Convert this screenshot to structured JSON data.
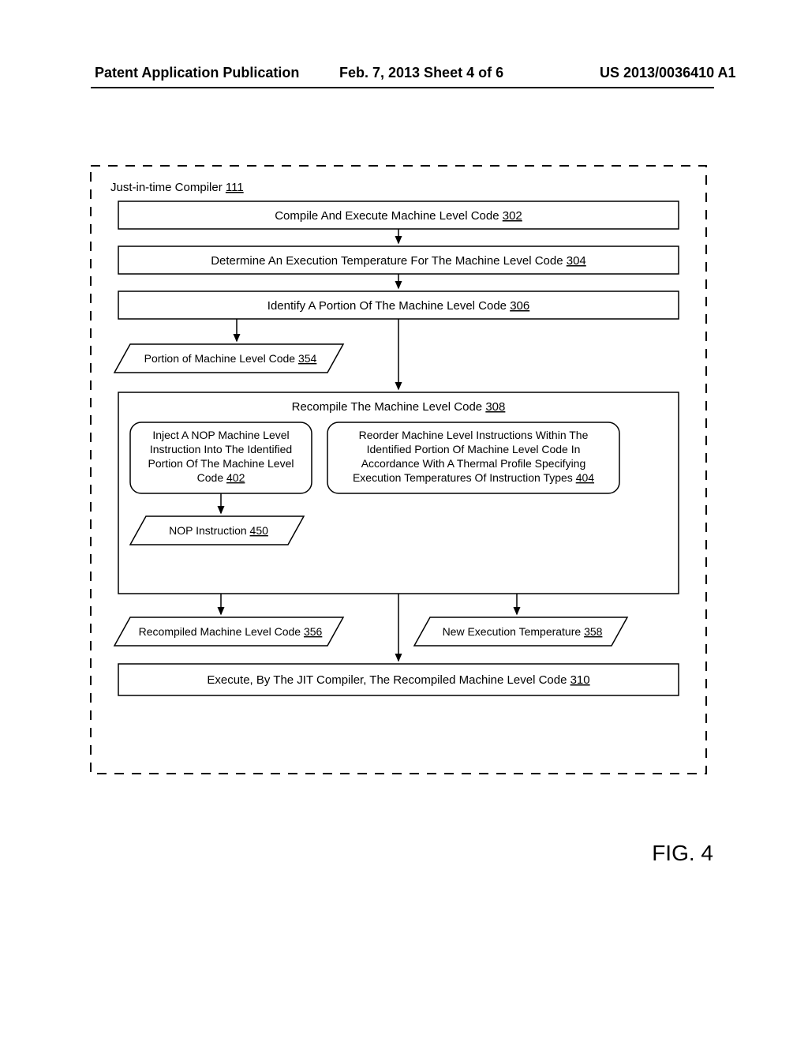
{
  "header": {
    "left": "Patent Application Publication",
    "center": "Feb. 7, 2013   Sheet 4 of 6",
    "right": "US 2013/0036410 A1"
  },
  "compiler_title": "Just-in-time Compiler ",
  "compiler_title_num": "111",
  "box302": {
    "text": "Compile And Execute Machine Level Code ",
    "num": "302"
  },
  "box304": {
    "text": "Determine An Execution Temperature For The Machine Level Code ",
    "num": "304"
  },
  "box306": {
    "text": "Identify A Portion Of The Machine Level Code  ",
    "num": "306"
  },
  "p354": {
    "text": "Portion of Machine Level Code ",
    "num": "354"
  },
  "box308": {
    "text": "Recompile The Machine Level Code  ",
    "num": "308"
  },
  "r402": {
    "l1": "Inject A NOP Machine Level",
    "l2": "Instruction Into The Identified",
    "l3": "Portion Of The Machine Level",
    "l4": "Code ",
    "num": "402"
  },
  "r404": {
    "l1": "Reorder Machine Level Instructions Within The",
    "l2": "Identified Portion Of Machine Level Code In",
    "l3": "Accordance With A Thermal Profile Specifying",
    "l4": "Execution Temperatures Of Instruction Types ",
    "num": "404"
  },
  "p450": {
    "text": "NOP Instruction ",
    "num": "450"
  },
  "p356": {
    "text": "Recompiled Machine Level Code ",
    "num": "356"
  },
  "p358": {
    "text": "New Execution Temperature ",
    "num": "358"
  },
  "box310": {
    "text": "Execute, By The JIT Compiler, The Recompiled Machine Level Code ",
    "num": "310"
  },
  "figure_label": "FIG. 4"
}
